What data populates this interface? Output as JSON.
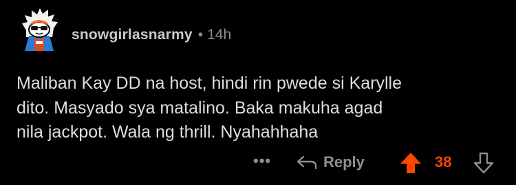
{
  "comment": {
    "author": "snowgirlasnarmy",
    "separator": "•",
    "timestamp": "14h",
    "avatar_icon": "snoo-avatar-icon",
    "body_lines": [
      "Maliban Kay DD na host, hindi rin pwede si Karylle",
      "dito. Masyado sya matalino. Baka makuha agad",
      "nila jackpot. Wala ng thrill. Nyahahhaha"
    ]
  },
  "actions": {
    "more_label": "•••",
    "reply_label": "Reply",
    "reply_icon": "reply-arrow-icon",
    "upvote_icon": "upvote-arrow-icon",
    "downvote_icon": "downvote-arrow-icon",
    "vote_count": "38",
    "upvoted": true
  },
  "colors": {
    "background": "#000000",
    "text": "#dcdedf",
    "muted": "#8b8e91",
    "upvote_accent": "#ff4500"
  }
}
